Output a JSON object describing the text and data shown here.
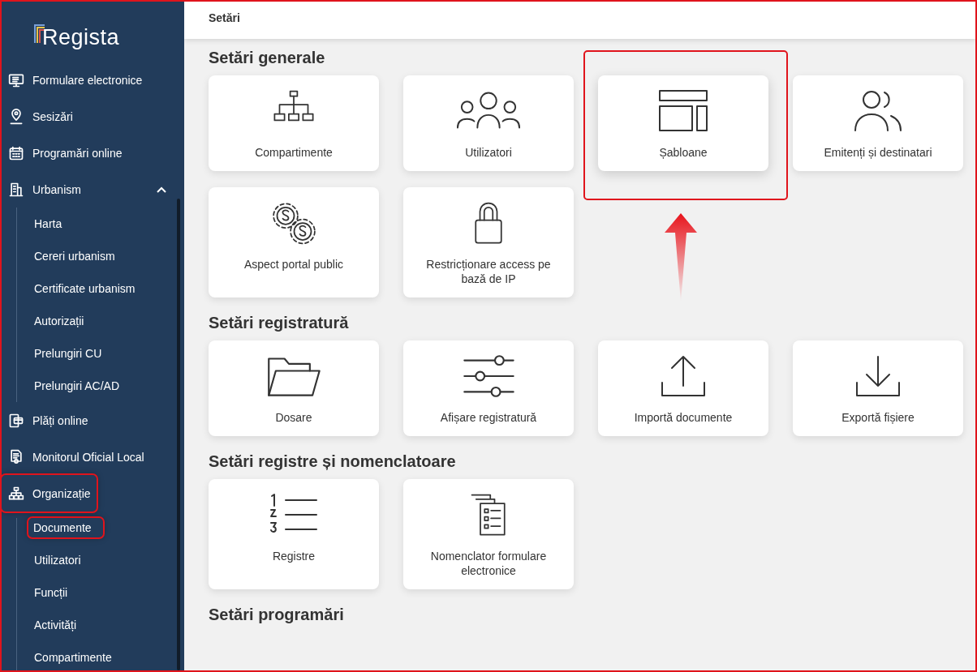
{
  "sidebar": {
    "logo": "Regista",
    "items": [
      {
        "label": "Formulare electronice",
        "highlighted": false
      },
      {
        "label": "Sesizări",
        "highlighted": false
      },
      {
        "label": "Programări online",
        "highlighted": false
      },
      {
        "label": "Urbanism",
        "expanded": true,
        "highlighted": false,
        "children": [
          {
            "label": "Harta",
            "highlighted": false
          },
          {
            "label": "Cereri urbanism",
            "highlighted": false
          },
          {
            "label": "Certificate urbanism",
            "highlighted": false
          },
          {
            "label": "Autorizații",
            "highlighted": false
          },
          {
            "label": "Prelungiri CU",
            "highlighted": false
          },
          {
            "label": "Prelungiri AC/AD",
            "highlighted": false
          }
        ]
      },
      {
        "label": "Plăți online",
        "highlighted": false
      },
      {
        "label": "Monitorul Oficial Local",
        "highlighted": false
      },
      {
        "label": "Organizație",
        "highlighted": true,
        "children": [
          {
            "label": "Documente",
            "highlighted": true
          },
          {
            "label": "Utilizatori",
            "highlighted": false
          },
          {
            "label": "Funcții",
            "highlighted": false
          },
          {
            "label": "Activități",
            "highlighted": false
          },
          {
            "label": "Compartimente",
            "highlighted": false
          }
        ]
      }
    ]
  },
  "header": {
    "title": "Setări"
  },
  "sections": [
    {
      "title": "Setări generale",
      "cards": [
        {
          "label": "Compartimente"
        },
        {
          "label": "Utilizatori"
        },
        {
          "label": "Șabloane",
          "highlighted": true
        },
        {
          "label": "Emitenți și destinatari"
        },
        {
          "label": "Aspect portal public"
        },
        {
          "label": "Restricționare access pe bază de IP"
        }
      ]
    },
    {
      "title": "Setări registratură",
      "cards": [
        {
          "label": "Dosare"
        },
        {
          "label": "Afișare registratură"
        },
        {
          "label": "Importă documente"
        },
        {
          "label": "Exportă fișiere"
        }
      ]
    },
    {
      "title": "Setări registre și nomenclatoare",
      "cards": [
        {
          "label": "Registre"
        },
        {
          "label": "Nomenclator formulare electronice"
        }
      ]
    },
    {
      "title": "Setări programări"
    }
  ],
  "annotation_arrow": true
}
